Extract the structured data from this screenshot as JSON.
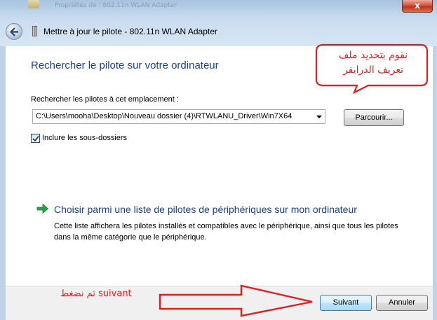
{
  "background_window": {
    "title": "Propriétés de : 802.11n WLAN Adapter"
  },
  "window": {
    "title": "Mettre à jour le pilote - 802.11n WLAN Adapter",
    "close_label": "x"
  },
  "main": {
    "heading": "Rechercher le pilote sur votre ordinateur",
    "location_label": "Rechercher les pilotes à cet emplacement :",
    "path_value": "C:\\Users\\mooha\\Desktop\\Nouveau dossier (4)\\RTWLANU_Driver\\Win7X64",
    "browse_label": "Parcourir...",
    "include_subfolders": {
      "label": "Inclure les sous-dossiers",
      "checked": true
    },
    "choose_link": {
      "title": "Choisir parmi une liste de pilotes de périphériques sur mon ordinateur",
      "description": "Cette liste affichera les pilotes installés et compatibles avec le périphérique, ainsi que tous les pilotes dans la même catégorie que le périphérique."
    }
  },
  "footer": {
    "next_label": "Suivant",
    "cancel_label": "Annuler"
  },
  "annotations": {
    "callout_line1": "نقوم بتحديد ملف",
    "callout_line2": "تعريف الدرايفر",
    "footer_note": "ثم نضغط suivant",
    "color": "#e01e1e"
  },
  "icons": {
    "back": "back-arrow-icon",
    "device": "device-icon",
    "choose": "green-arrow-icon",
    "check": "checkmark-icon"
  }
}
